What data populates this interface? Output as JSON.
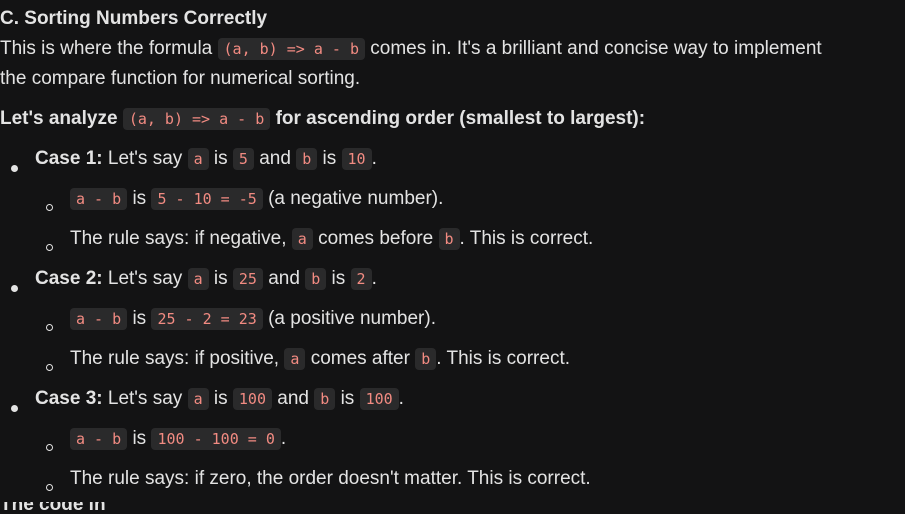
{
  "heading": "C. Sorting Numbers Correctly",
  "intro": {
    "t1": "This is where the formula",
    "code": "(a, b) => a - b",
    "t2": "comes in. It's a brilliant and concise way to implement",
    "t3": "the compare function for numerical sorting."
  },
  "analyze": {
    "t1": "Let's analyze",
    "code": "(a, b) => a - b",
    "t2": "for ascending order (smallest to largest):"
  },
  "cases": [
    {
      "label": "Case 1:",
      "say": "Let's say",
      "a": "a",
      "is1": "is",
      "av": "5",
      "and": "and",
      "b": "b",
      "is2": "is",
      "bv": "10",
      "end": ".",
      "sub1": {
        "code1": "a - b",
        "is": "is",
        "code2": "5 - 10 = -5",
        "text": "(a negative number)."
      },
      "sub2": {
        "t1": "The rule says: if negative,",
        "a": "a",
        "t2": "comes before",
        "b": "b",
        "t3": ". This is correct."
      }
    },
    {
      "label": "Case 2:",
      "say": "Let's say",
      "a": "a",
      "is1": "is",
      "av": "25",
      "and": "and",
      "b": "b",
      "is2": "is",
      "bv": "2",
      "end": ".",
      "sub1": {
        "code1": "a - b",
        "is": "is",
        "code2": "25 - 2 = 23",
        "text": "(a positive number)."
      },
      "sub2": {
        "t1": "The rule says: if positive,",
        "a": "a",
        "t2": "comes after",
        "b": "b",
        "t3": ". This is correct."
      }
    },
    {
      "label": "Case 3:",
      "say": "Let's say",
      "a": "a",
      "is1": "is",
      "av": "100",
      "and": "and",
      "b": "b",
      "is2": "is",
      "bv": "100",
      "end": ".",
      "sub1": {
        "code1": "a - b",
        "is": "is",
        "code2": "100 - 100 = 0",
        "text": "."
      },
      "sub2": {
        "t1": "The rule says: if zero, the order doesn't matter. This is correct."
      }
    }
  ],
  "cutoff": "The code in action"
}
